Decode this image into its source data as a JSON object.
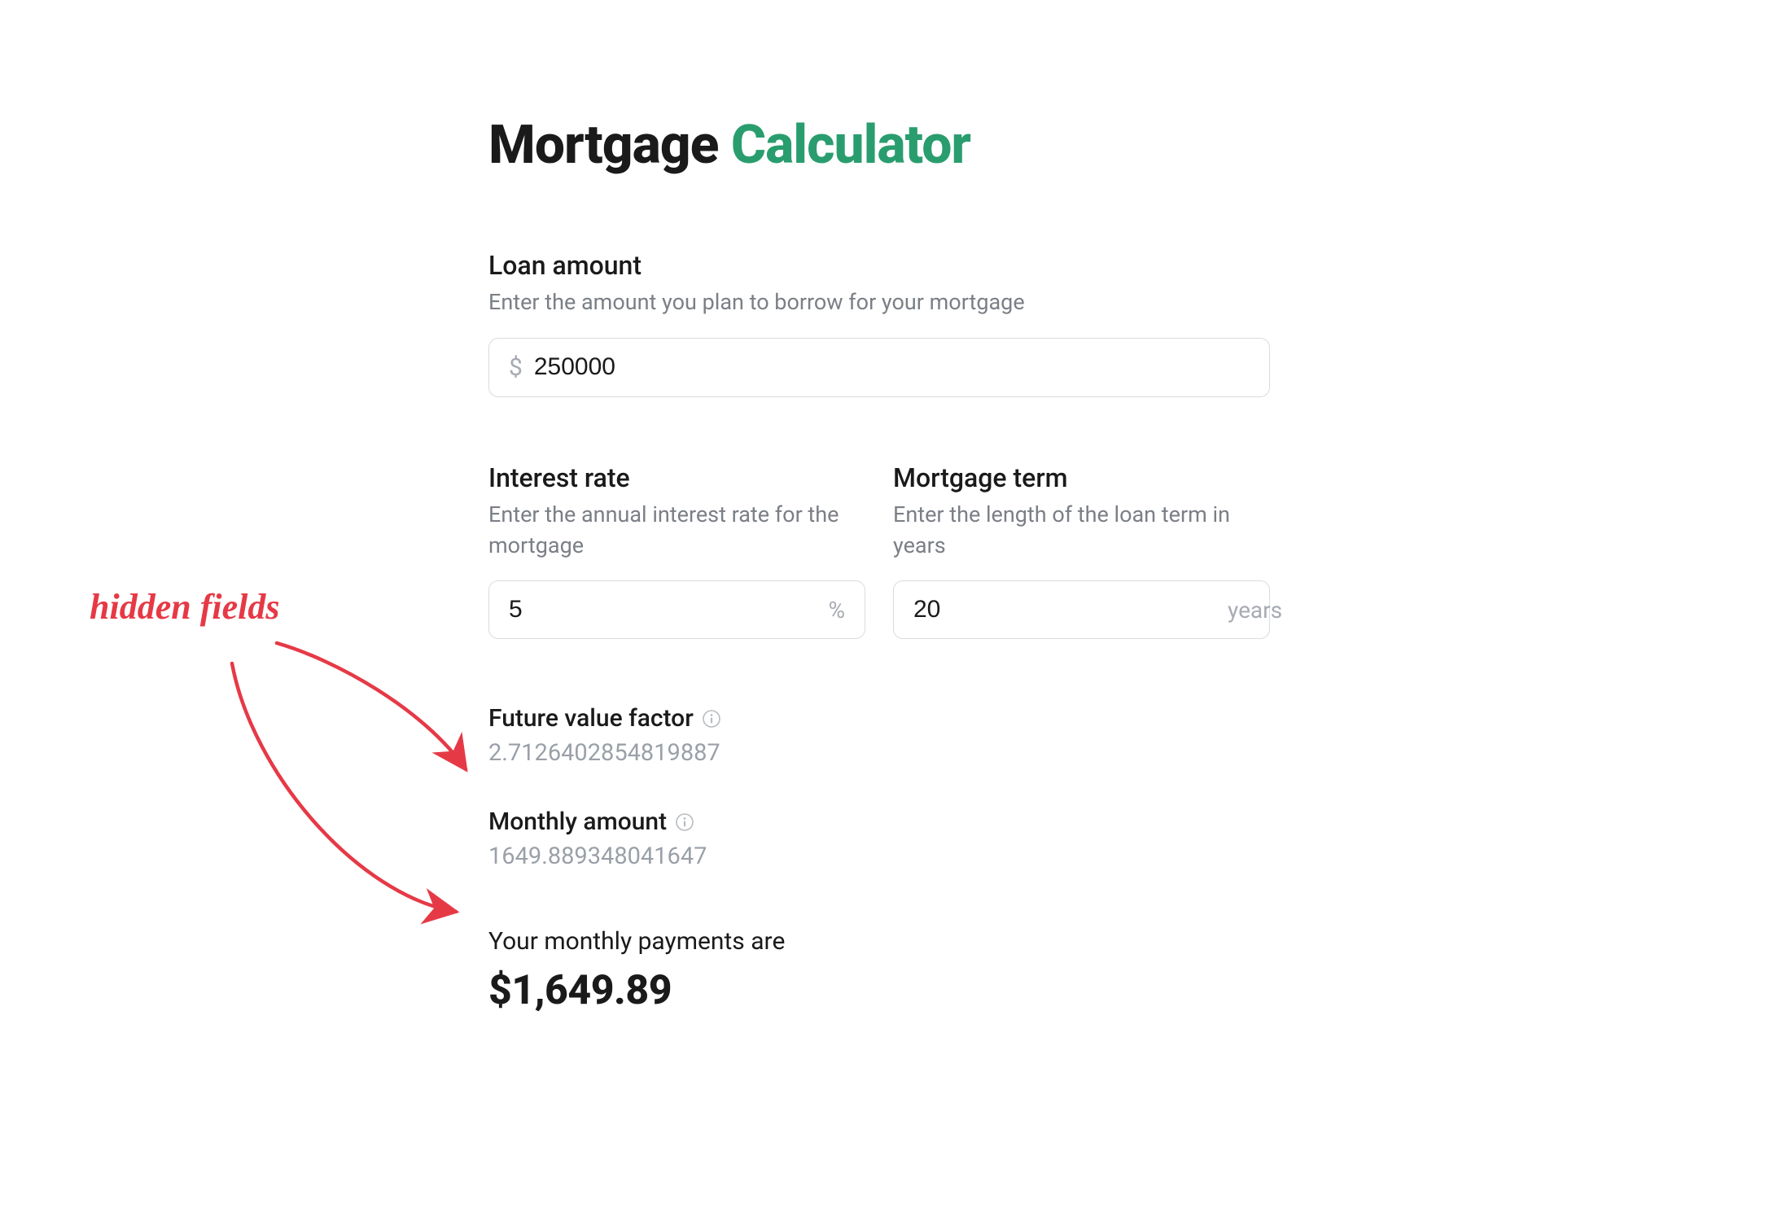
{
  "title": {
    "part1": "Mortgage ",
    "part2": "Calculator"
  },
  "loan": {
    "label": "Loan amount",
    "help": "Enter the amount you plan to borrow for your mortgage",
    "prefix": "$",
    "value": "250000"
  },
  "rate": {
    "label": "Interest rate",
    "help": "Enter the annual interest rate for the mortgage",
    "value": "5",
    "suffix": "%"
  },
  "term": {
    "label": "Mortgage term",
    "help": "Enter the length of the loan term in years",
    "value": "20",
    "suffix": "years"
  },
  "hidden": {
    "fvf": {
      "label": "Future value factor",
      "value": "2.7126402854819887"
    },
    "monthly": {
      "label": "Monthly amount",
      "value": "1649.889348041647"
    }
  },
  "result": {
    "label": "Your monthly payments are",
    "value": "$1,649.89"
  },
  "annotation": {
    "text": "hidden fields"
  }
}
